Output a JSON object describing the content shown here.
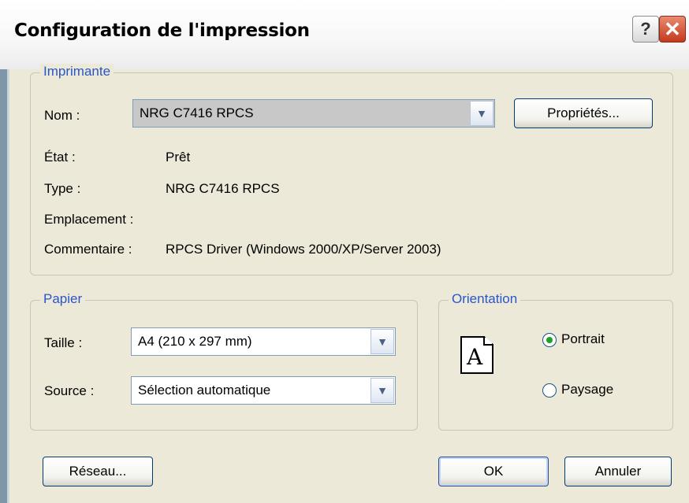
{
  "window": {
    "title": "Configuration de l'impression",
    "help_glyph": "?",
    "close_glyph": "✕"
  },
  "printer": {
    "legend": "Imprimante",
    "name_label": "Nom :",
    "name_value": "NRG C7416 RPCS",
    "properties_label": "Propriétés...",
    "status_label": "État :",
    "status_value": "Prêt",
    "type_label": "Type :",
    "type_value": "NRG C7416 RPCS",
    "location_label": "Emplacement :",
    "location_value": "",
    "comment_label": "Commentaire :",
    "comment_value": "RPCS Driver (Windows 2000/XP/Server 2003)"
  },
  "paper": {
    "legend": "Papier",
    "size_label": "Taille :",
    "size_value": "A4 (210 x 297 mm)",
    "source_label": "Source :",
    "source_value": "Sélection automatique"
  },
  "orientation": {
    "legend": "Orientation",
    "icon_letter": "A",
    "portrait_label": "Portrait",
    "landscape_label": "Paysage",
    "selected": "portrait"
  },
  "buttons": {
    "network": "Réseau...",
    "ok": "OK",
    "cancel": "Annuler"
  },
  "icons": {
    "dropdown": "chevron-down-icon"
  }
}
